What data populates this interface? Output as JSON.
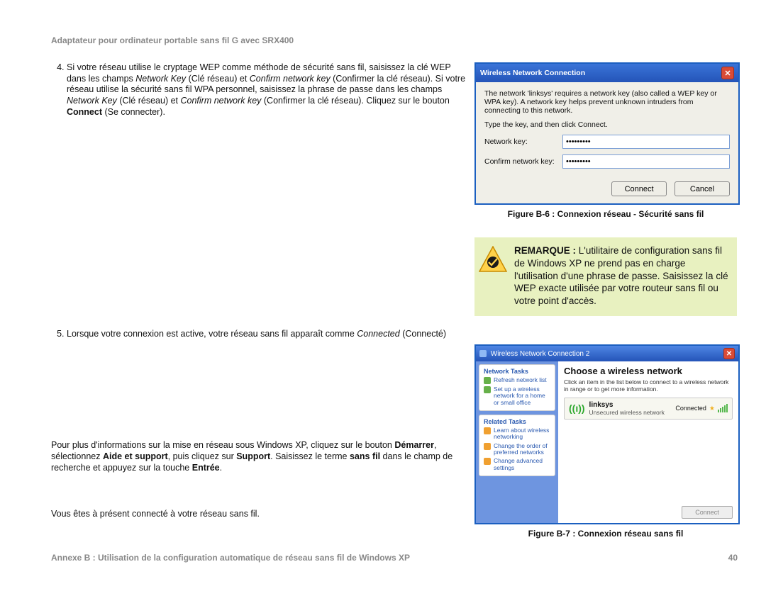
{
  "header": "Adaptateur pour ordinateur portable sans fil G avec SRX400",
  "footer": {
    "left": "Annexe B : Utilisation de la configuration automatique de réseau sans fil de Windows XP",
    "right": "40"
  },
  "step4": {
    "num": "4.",
    "a": "Si votre réseau utilise le cryptage WEP comme méthode de sécurité sans fil, saisissez la clé WEP dans les champs ",
    "i1": "Network Key",
    "b": " (Clé réseau) et ",
    "i2": "Confirm network key",
    "c": " (Confirmer la clé réseau). Si votre réseau utilise la sécurité sans fil WPA personnel, saisissez la phrase de passe dans les champs ",
    "i3": "Network Key",
    "d": " (Clé réseau) et ",
    "i4": "Confirm network key",
    "e": " (Confirmer la clé réseau). Cliquez sur le bouton ",
    "b1": "Connect",
    "f": " (Se connecter)."
  },
  "step5": {
    "num": "5.",
    "a": "Lorsque votre connexion est active, votre réseau sans fil apparaît comme ",
    "i1": "Connected",
    "b": " (Connecté)"
  },
  "para1": {
    "a": "Pour plus d'informations sur la mise en réseau sous Windows XP, cliquez sur le bouton ",
    "b1": "Démarrer",
    "b": ", sélectionnez ",
    "b2": "Aide et support",
    "c": ", puis cliquez sur ",
    "b3": "Support",
    "d": ". Saisissez le terme ",
    "b4": "sans fil",
    "e": " dans le champ de recherche et appuyez sur la touche ",
    "b5": "Entrée",
    "f": "."
  },
  "para2": "Vous êtes à présent connecté à votre réseau sans fil.",
  "figB6": "Figure B-6 : Connexion réseau - Sécurité sans fil",
  "figB7": "Figure B-7 : Connexion réseau sans fil",
  "note": {
    "lead": "REMARQUE :",
    "text": " L'utilitaire de configuration sans fil de Windows XP ne prend pas en charge l'utilisation d'une phrase de passe. Saisissez la clé WEP exacte utilisée par votre routeur sans fil ou votre point d'accès."
  },
  "dlg6": {
    "title": "Wireless Network Connection",
    "desc": "The network 'linksys' requires a network key (also called a WEP key or WPA key). A network key helps prevent unknown intruders from connecting to this network.",
    "instr": "Type the key, and then click Connect.",
    "lbl1": "Network key:",
    "lbl2": "Confirm network key:",
    "val": "•••••••••",
    "btnConnect": "Connect",
    "btnCancel": "Cancel"
  },
  "win7": {
    "title": "Wireless Network Connection 2",
    "sideHd1": "Network Tasks",
    "s1": "Refresh network list",
    "s2": "Set up a wireless network for a home or small office",
    "sideHd2": "Related Tasks",
    "s3": "Learn about wireless networking",
    "s4": "Change the order of preferred networks",
    "s5": "Change advanced settings",
    "mainHd": "Choose a wireless network",
    "mainSub": "Click an item in the list below to connect to a wireless network in range or to get more information.",
    "netName": "linksys",
    "netSec": "Unsecured wireless network",
    "netStat": "Connected",
    "btn": "Connect"
  }
}
